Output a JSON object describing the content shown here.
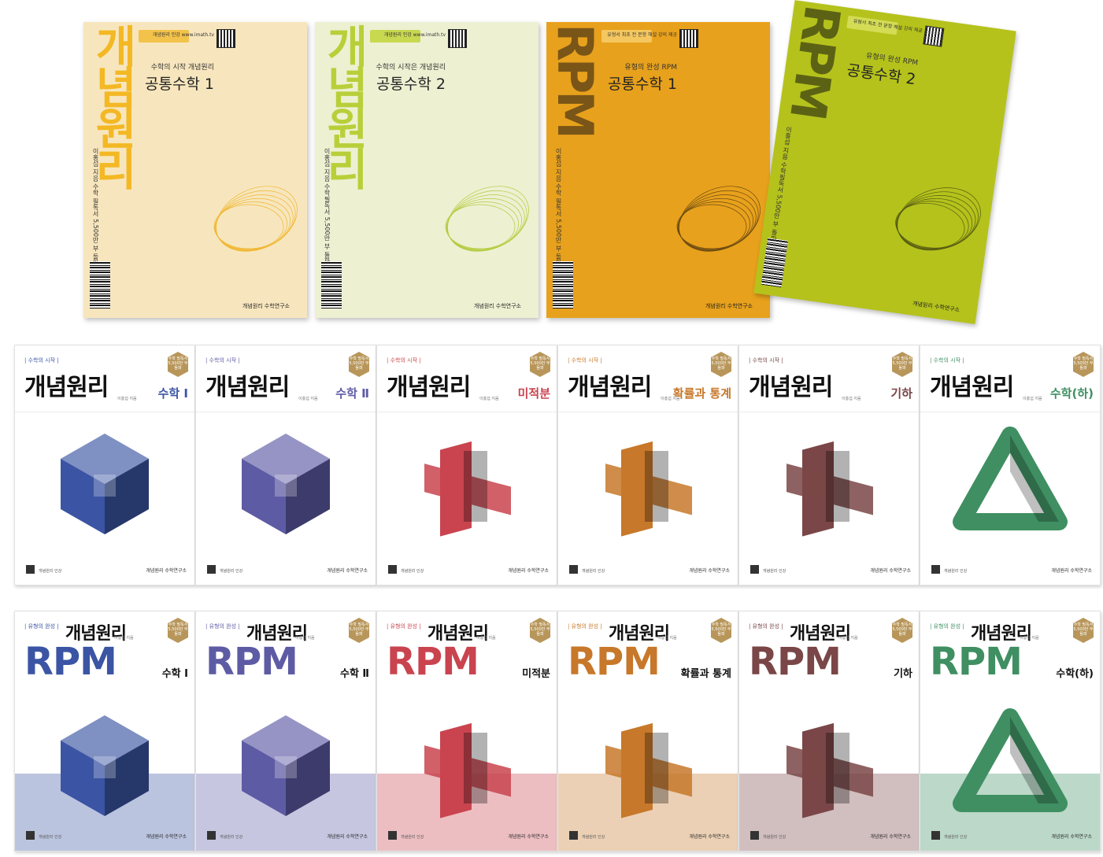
{
  "top_row": [
    {
      "spine": "개념원리",
      "tagline": "수학의 시작 개념원리",
      "title": "공통수학 1",
      "qr_label": "개념원리 인강\nwww.imath.tv",
      "side_text": "이홍섭 지음  수학 필독서 5,500만 부 돌파!",
      "publisher": "개념원리 수학연구소",
      "bg": "#f7e6bd",
      "accent": "#f0b120",
      "spine_color": "#f3b824"
    },
    {
      "spine": "개념원리",
      "tagline": "수학의 시작은 개념원리",
      "title": "공통수학 2",
      "qr_label": "개념원리 인강\nwww.imath.tv",
      "side_text": "이홍섭 지음  수학필독서 5,500만 부 돌파!",
      "publisher": "개념원리 수학연구소",
      "bg": "#eef0d2",
      "accent": "#b2cc3d",
      "spine_color": "#b9cf3a"
    },
    {
      "spine": "RPM",
      "tagline": "유형의 완성 RPM",
      "title": "공통수학 1",
      "qr_label": "유형서 최초\n전 문항 해설 강의 제공",
      "side_text": "이홍섭 지음  수학 필독서 5,500만 부 돌파!",
      "publisher": "개념원리 수학연구소",
      "bg": "#e8a11c",
      "accent": "#6b4a12",
      "spine_color": "#7a5518"
    },
    {
      "spine": "RPM",
      "tagline": "유형의 완성 RPM",
      "title": "공통수학 2",
      "qr_label": "유형서 최초\n전 문항 해설 강의 제공",
      "side_text": "이홍섭 지음  수학필독서 5,500만 부 돌파!",
      "publisher": "개념원리 수학연구소",
      "bg": "#b5c21c",
      "accent": "#555a10",
      "spine_color": "#5c6214"
    }
  ],
  "middle_row": [
    {
      "tag": "| 수학의 시작 |",
      "brand": "개념원리",
      "author": "이홍섭 지음",
      "subject": "수학 Ⅰ",
      "color": "#3b55a4",
      "seal": "수학 필독서 5,500만 부 돌파",
      "qr_text": "개념원리 인강",
      "publisher": "개념원리 수학연구소",
      "shape": "cube"
    },
    {
      "tag": "| 수학의 시작 |",
      "brand": "개념원리",
      "author": "이홍섭 지음",
      "subject": "수학 Ⅱ",
      "color": "#5e5ba5",
      "seal": "수학 필독서 5,500만 부 돌파",
      "qr_text": "개념원리 인강",
      "publisher": "개념원리 수학연구소",
      "shape": "cube"
    },
    {
      "tag": "| 수학의 시작 |",
      "brand": "개념원리",
      "author": "이홍섭 지음",
      "subject": "미적분",
      "color": "#c9444f",
      "seal": "수학 필독서 5,500만 부 돌파",
      "qr_text": "개념원리 인강",
      "publisher": "개념원리 수학연구소",
      "shape": "cross"
    },
    {
      "tag": "| 수학의 시작 |",
      "brand": "개념원리",
      "author": "이홍섭 지음",
      "subject": "확률과 통계",
      "color": "#c7782a",
      "seal": "수학 필독서 5,500만 부 돌파",
      "qr_text": "개념원리 인강",
      "publisher": "개념원리 수학연구소",
      "shape": "cross"
    },
    {
      "tag": "| 수학의 시작 |",
      "brand": "개념원리",
      "author": "이홍섭 지음",
      "subject": "기하",
      "color": "#7a4647",
      "seal": "수학 필독서 5,500만 부 돌파",
      "qr_text": "개념원리 인강",
      "publisher": "개념원리 수학연구소",
      "shape": "cross"
    },
    {
      "tag": "| 수학의 시작 |",
      "brand": "개념원리",
      "author": "이홍섭 지음",
      "subject": "수학(하)",
      "color": "#3f8f62",
      "seal": "수학 필독서 5,500만 부 돌파",
      "qr_text": "개념원리 인강",
      "publisher": "개념원리 수학연구소",
      "shape": "triangle"
    }
  ],
  "bottom_row": [
    {
      "tag": "| 유형의 완성 |",
      "brand": "개념원리",
      "author": "이홍섭 지음",
      "rpm": "RPM",
      "subject": "수학 Ⅰ",
      "color": "#3b55a4",
      "seal": "수학 필독서 5,500만 부 돌파",
      "qr_text": "개념원리 인강",
      "publisher": "개념원리 수학연구소",
      "shape": "cube"
    },
    {
      "tag": "| 유형의 완성 |",
      "brand": "개념원리",
      "author": "이홍섭 지음",
      "rpm": "RPM",
      "subject": "수학 Ⅱ",
      "color": "#5e5ba5",
      "seal": "수학 필독서 5,500만 부 돌파",
      "qr_text": "개념원리 인강",
      "publisher": "개념원리 수학연구소",
      "shape": "cube"
    },
    {
      "tag": "| 유형의 완성 |",
      "brand": "개념원리",
      "author": "이홍섭 지음",
      "rpm": "RPM",
      "subject": "미적분",
      "color": "#c9444f",
      "seal": "수학 필독서 5,500만 부 돌파",
      "qr_text": "개념원리 인강",
      "publisher": "개념원리 수학연구소",
      "shape": "cross"
    },
    {
      "tag": "| 유형의 완성 |",
      "brand": "개념원리",
      "author": "이홍섭 지음",
      "rpm": "RPM",
      "subject": "확률과 통계",
      "color": "#c7782a",
      "seal": "수학 필독서 5,500만 부 돌파",
      "qr_text": "개념원리 인강",
      "publisher": "개념원리 수학연구소",
      "shape": "cross"
    },
    {
      "tag": "| 유형의 완성 |",
      "brand": "개념원리",
      "author": "이홍섭 지음",
      "rpm": "RPM",
      "subject": "기하",
      "color": "#7a4647",
      "seal": "수학 필독서 5,500만 부 돌파",
      "qr_text": "개념원리 인강",
      "publisher": "개념원리 수학연구소",
      "shape": "cross"
    },
    {
      "tag": "| 유형의 완성 |",
      "brand": "개념원리",
      "author": "이홍섭 지음",
      "rpm": "RPM",
      "subject": "수학(하)",
      "color": "#3f8f62",
      "seal": "수학 필독서 5,500만 부 돌파",
      "qr_text": "개념원리 인강",
      "publisher": "개념원리 수학연구소",
      "shape": "triangle"
    }
  ]
}
